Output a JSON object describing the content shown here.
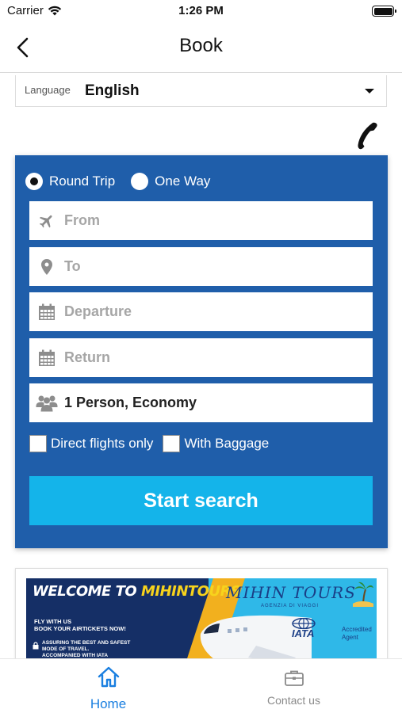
{
  "status_bar": {
    "carrier": "Carrier",
    "time": "1:26 PM"
  },
  "nav": {
    "title": "Book",
    "back_icon": "chevron-left-icon"
  },
  "language": {
    "label": "Language",
    "value": "English"
  },
  "search": {
    "trip_types": [
      {
        "label": "Round Trip",
        "selected": true
      },
      {
        "label": "One Way",
        "selected": false
      }
    ],
    "from_placeholder": "From",
    "to_placeholder": "To",
    "departure_placeholder": "Departure",
    "return_placeholder": "Return",
    "passengers_value": "1 Person, Economy",
    "options": [
      {
        "label": "Direct flights only",
        "checked": false
      },
      {
        "label": "With Baggage",
        "checked": false
      }
    ],
    "button_label": "Start search"
  },
  "banner": {
    "welcome": "WELCOME TO ",
    "brand": "MIHINTOURS",
    "fly_line1": "FLY WITH US",
    "fly_line2": "BOOK YOUR AIRTICKETS NOW!",
    "assure_line1": "ASSURING THE BEST AND SAFEST",
    "assure_line2": "MODE OF TRAVEL.",
    "assure_line3": "ACCOMPANIED WITH IATA",
    "logo": "MIHIN TOURS",
    "logo_sub": "AGENZIA DI VIAGGI",
    "iata": "IATA",
    "accredited_line1": "Accredited",
    "accredited_line2": "Agent"
  },
  "tabs": [
    {
      "label": "Home",
      "icon": "home-icon",
      "active": true
    },
    {
      "label": "Contact us",
      "icon": "briefcase-icon",
      "active": false
    }
  ],
  "colors": {
    "panel": "#1f5eaa",
    "button": "#14b4ea",
    "active_tab": "#1a7fe0"
  }
}
